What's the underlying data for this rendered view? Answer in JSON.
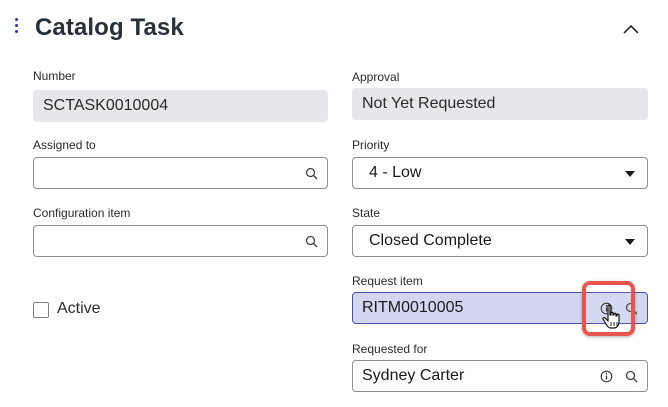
{
  "section": {
    "title": "Catalog Task"
  },
  "fields": {
    "number": {
      "label": "Number",
      "value": "SCTASK0010004"
    },
    "approval": {
      "label": "Approval",
      "value": "Not Yet Requested"
    },
    "assigned_to": {
      "label": "Assigned to",
      "value": ""
    },
    "priority": {
      "label": "Priority",
      "value": "4 - Low"
    },
    "configuration_item": {
      "label": "Configuration item",
      "value": ""
    },
    "state": {
      "label": "State",
      "value": "Closed Complete"
    },
    "request_item": {
      "label": "Request item",
      "value": "RITM0010005"
    },
    "requested_for": {
      "label": "Requested for",
      "value": "Sydney Carter"
    },
    "active": {
      "label": "Active",
      "checked": false
    }
  },
  "icons": {
    "section_menu": "kebab-icon",
    "collapse": "chevron-up-icon",
    "lookup": "search-icon",
    "preview": "info-icon",
    "dropdown": "caret-down-icon",
    "pointer": "hand-cursor-icon"
  },
  "colors": {
    "accent": "#2f3a9a",
    "highlight_fill": "#d3d6f1",
    "focus_ring": "#e8554e",
    "readonly_fill": "#e6e7ea"
  }
}
